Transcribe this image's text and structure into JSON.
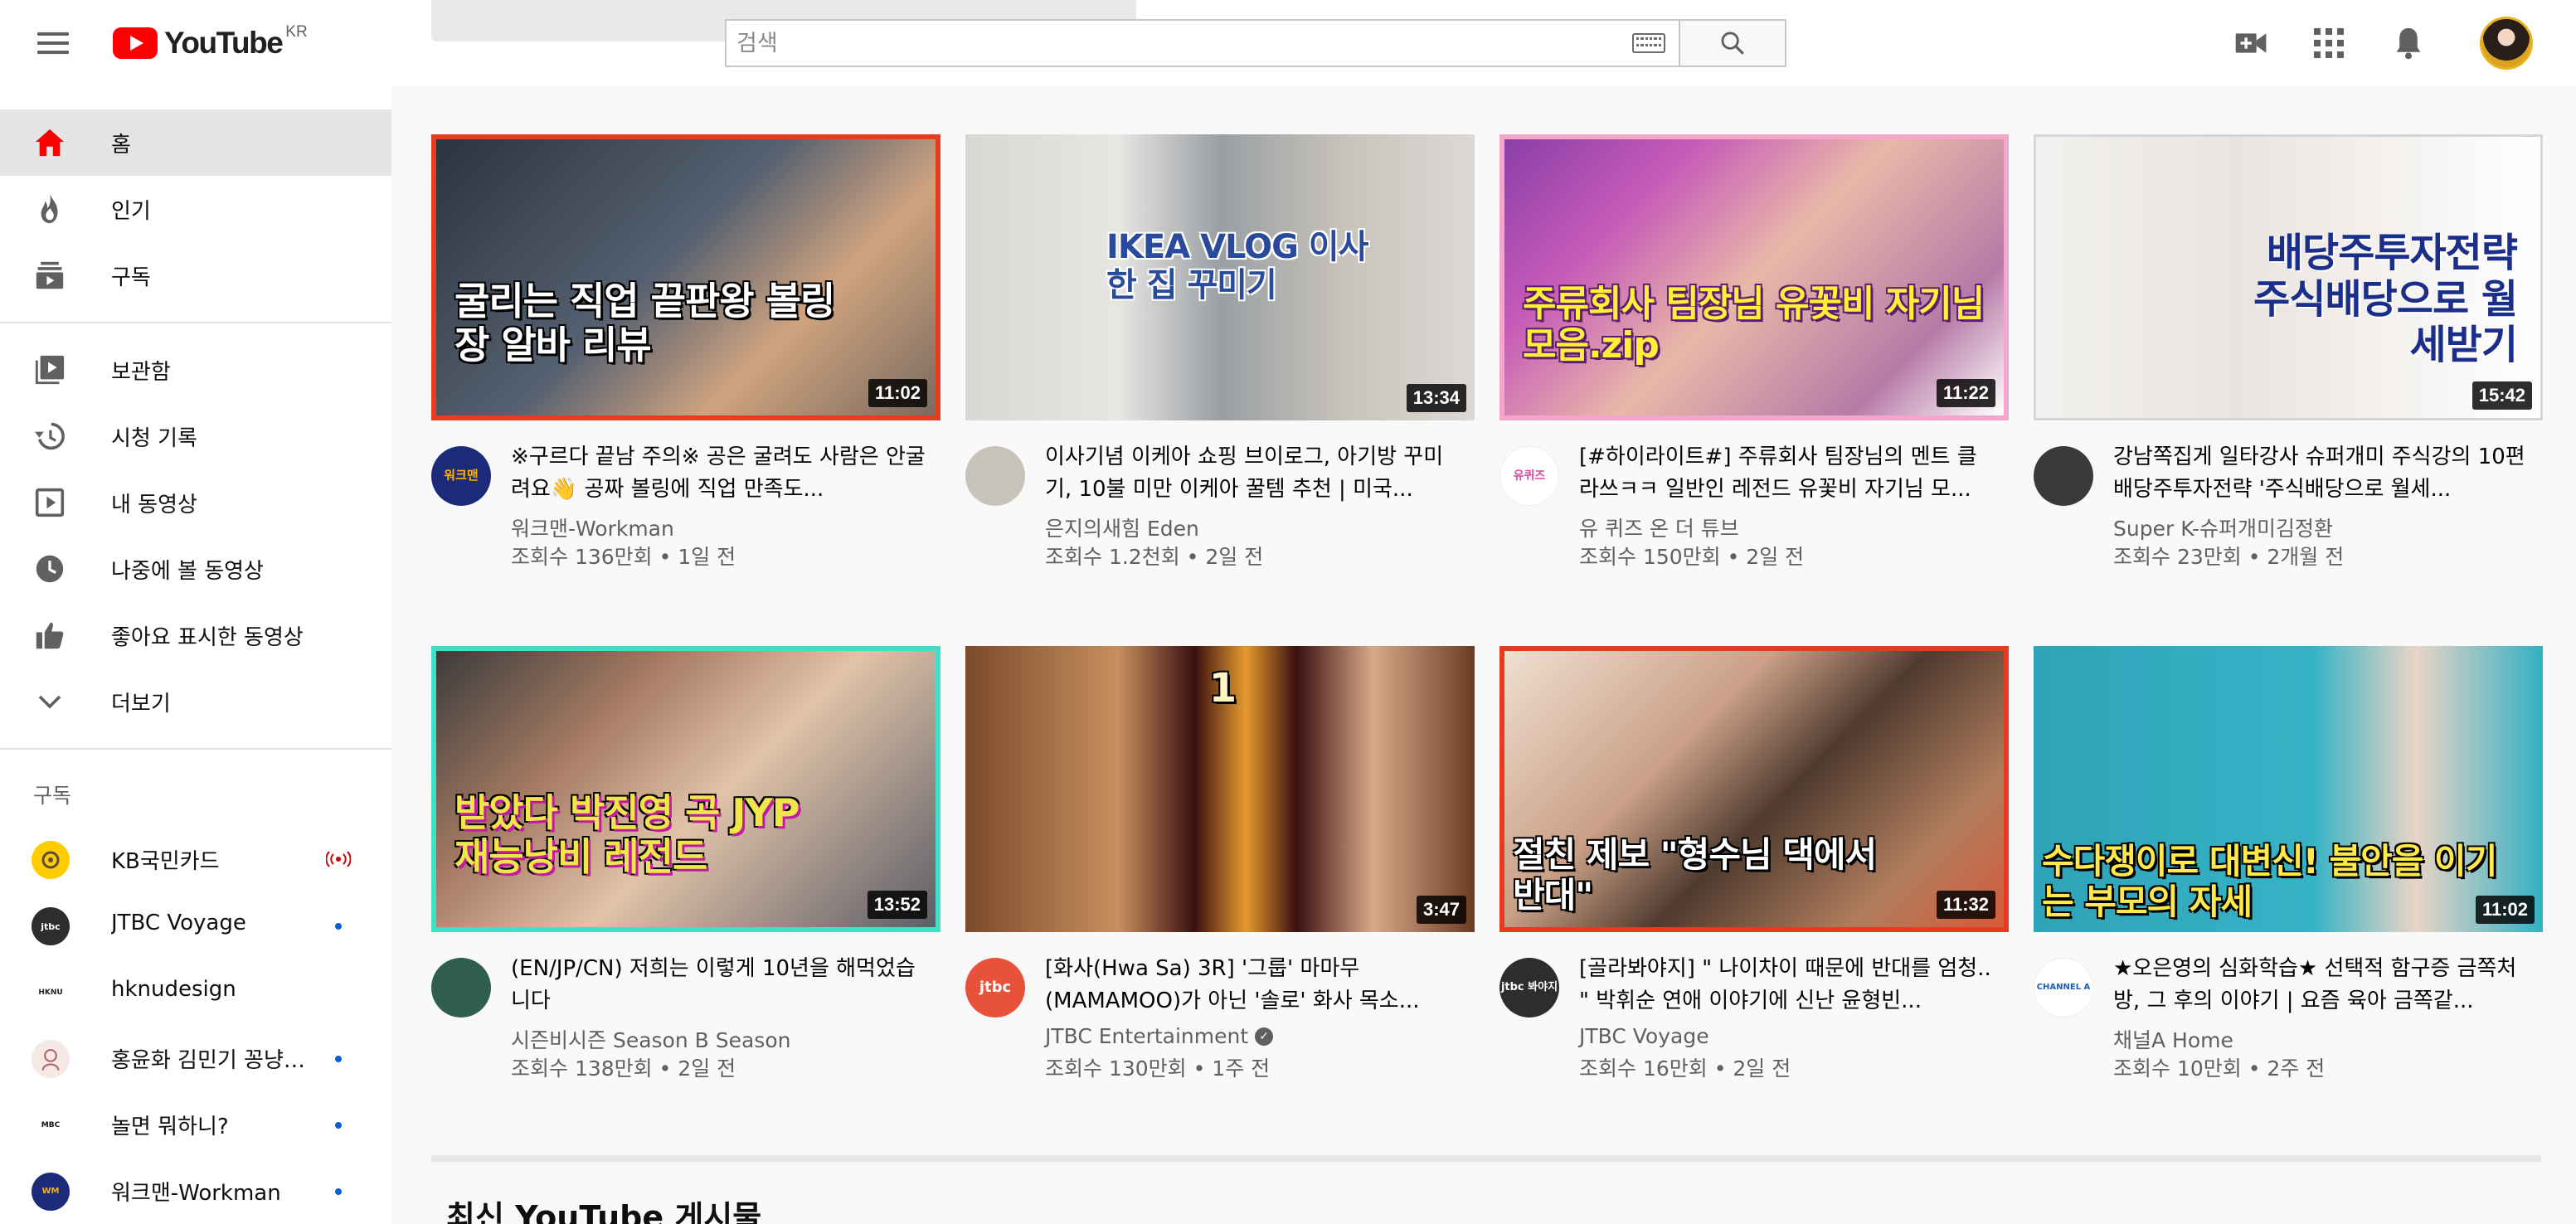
{
  "header": {
    "logo_text": "YouTube",
    "country_code": "KR",
    "search_placeholder": "검색"
  },
  "sidebar": {
    "main_items": [
      {
        "label": "홈",
        "icon": "home-icon",
        "active": true
      },
      {
        "label": "인기",
        "icon": "trending-flame-icon"
      },
      {
        "label": "구독",
        "icon": "subscriptions-icon"
      }
    ],
    "library_items": [
      {
        "label": "보관함",
        "icon": "library-icon"
      },
      {
        "label": "시청 기록",
        "icon": "history-icon"
      },
      {
        "label": "내 동영상",
        "icon": "your-videos-icon"
      },
      {
        "label": "나중에 볼 동영상",
        "icon": "watch-later-icon"
      },
      {
        "label": "좋아요 표시한 동영상",
        "icon": "thumbs-up-icon"
      },
      {
        "label": "더보기",
        "icon": "chevron-down-icon"
      }
    ],
    "subscriptions_title": "구독",
    "subscriptions": [
      {
        "name": "KB국민카드",
        "indicator": "live"
      },
      {
        "name": "JTBC Voyage",
        "indicator": "new"
      },
      {
        "name": "hknudesign",
        "indicator": "none"
      },
      {
        "name": "홍윤화 김민기 꽁냥꽁...",
        "indicator": "new"
      },
      {
        "name": "놀면 뭐하니?",
        "indicator": "new"
      },
      {
        "name": "워크맨-Workman",
        "indicator": "new"
      }
    ]
  },
  "videos": [
    {
      "title": "※구르다 끝남 주의※ 공은 굴려도 사람은 안굴려요👋 공짜 볼링에 직업 만족도...",
      "channel": "워크맨-Workman",
      "meta": "조회수 136만회 • 1일 전",
      "duration": "11:02",
      "thumb_text": "굴리는 직업 끝판왕 볼링장 알바 리뷰",
      "avatar_text": "워크맨"
    },
    {
      "title": "이사기념 이케아 쇼핑 브이로그, 아기방 꾸미기, 10불 미만 이케아 꿀템 추천 | 미국...",
      "channel": "은지의새힘 Eden",
      "meta": "조회수 1.2천회 • 2일 전",
      "duration": "13:34",
      "thumb_text": "IKEA VLOG 이사한 집 꾸미기",
      "avatar_text": ""
    },
    {
      "title": "[#하이라이트#] 주류회사 팀장님의 멘트 클라쓰ㅋㅋ 일반인 레전드 유꽃비 자기님 모...",
      "channel": "유 퀴즈 온 더 튜브",
      "meta": "조회수 150만회 • 2일 전",
      "duration": "11:22",
      "thumb_text": "주류회사 팀장님 유꽃비 자기님 모음.zip",
      "avatar_text": "유퀴즈"
    },
    {
      "title": "강남쪽집게 일타강사 슈퍼개미 주식강의 10편 배당주투자전략 '주식배당으로 월세...",
      "channel": "Super K-슈퍼개미김정환",
      "meta": "조회수 23만회 • 2개월 전",
      "duration": "15:42",
      "thumb_text": "배당주투자전략 주식배당으로 월세받기",
      "avatar_text": ""
    },
    {
      "title": "(EN/JP/CN) 저희는 이렇게 10년을 해먹었습니다",
      "channel": "시즌비시즌 Season B Season",
      "meta": "조회수 138만회 • 2일 전",
      "duration": "13:52",
      "thumb_text": "받았다 박진영 곡 JYP 재능낭비 레전드",
      "avatar_text": ""
    },
    {
      "title": "[화사(Hwa Sa) 3R] '그룹' 마마무(MAMAMOO)가 아닌 '솔로' 화사 목소...",
      "channel": "JTBC Entertainment",
      "verified": true,
      "meta": "조회수 130만회 • 1주 전",
      "duration": "3:47",
      "thumb_text": "1",
      "avatar_text": "jtbc"
    },
    {
      "title": "[골라봐야지] \" 나이차이 때문에 반대를 엄청.. \" 박휘순 연애 이야기에 신난 윤형빈...",
      "channel": "JTBC Voyage",
      "meta": "조회수 16만회 • 2일 전",
      "duration": "11:32",
      "thumb_text": "절친 제보 \"형수님 댁에서 반대\"",
      "avatar_text": "jtbc 봐야지"
    },
    {
      "title": "★오은영의 심화학습★ 선택적 함구증 금쪽처방, 그 후의 이야기 | 요즘 육아 금쪽같...",
      "channel": "채널A Home",
      "meta": "조회수 10만회 • 2주 전",
      "duration": "11:02",
      "thumb_text": "수다쟁이로 대변신! 불안을 이기는 부모의 자세",
      "avatar_text": "CHANNEL A"
    }
  ],
  "next_section_title": "최신 YouTube 게시물"
}
